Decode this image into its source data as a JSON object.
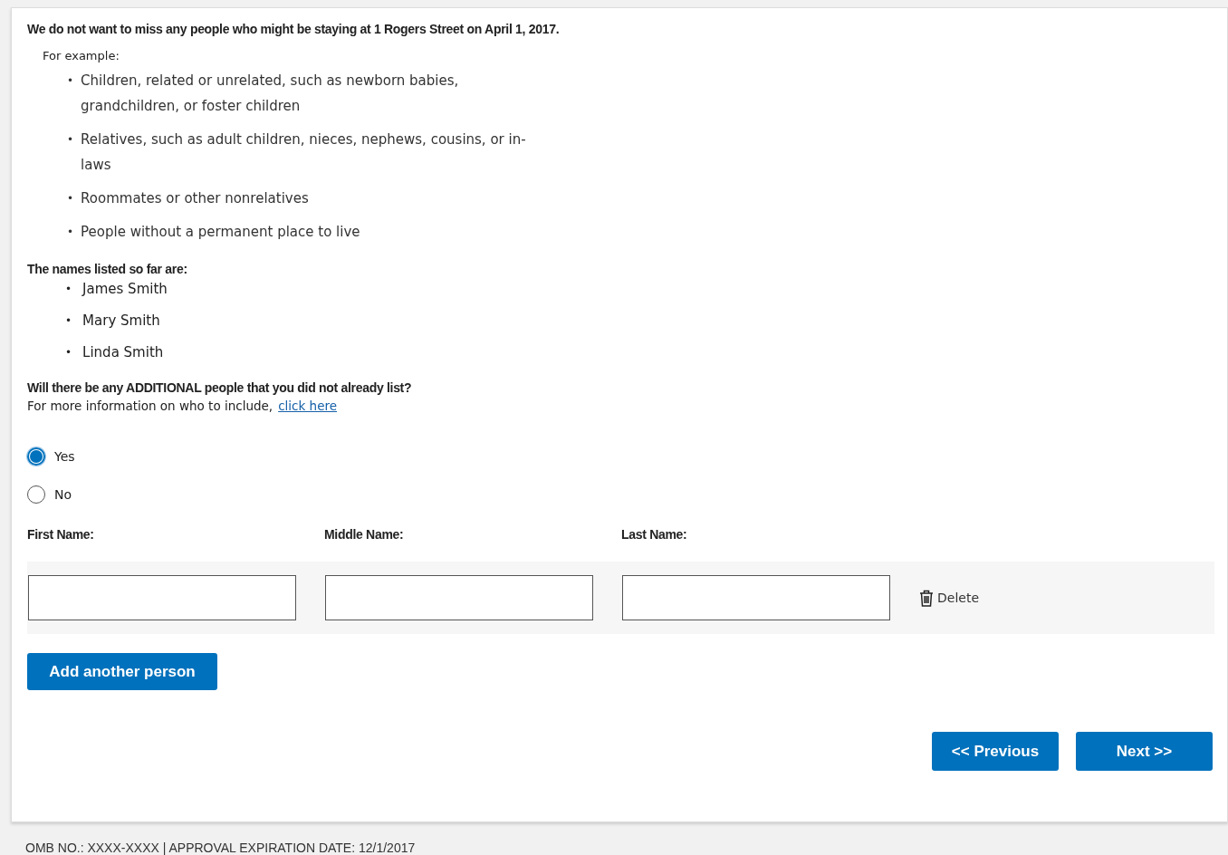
{
  "intro": {
    "heading": "We do not want to miss any people who might be staying at 1 Rogers Street on April 1, 2017.",
    "example_label": "For example:",
    "bullet": "•",
    "examples": [
      "Children, related or unrelated, such as newborn babies, grandchildren, or foster children",
      "Relatives, such as adult children, nieces, nephews, cousins, or in-laws",
      "Roommates or other nonrelatives",
      "People without a permanent place to live"
    ]
  },
  "listed": {
    "heading": "The names listed so far are:",
    "bullet": "•",
    "names": [
      "James Smith",
      "Mary Smith",
      "Linda Smith"
    ]
  },
  "question": {
    "text": "Will there be any ADDITIONAL people that you did not already list?",
    "info": "For more information on who to include,",
    "link": "click here",
    "options": [
      {
        "label": "Yes",
        "selected": true
      },
      {
        "label": "No",
        "selected": false
      }
    ]
  },
  "person_form": {
    "columns": [
      "First Name:",
      "Middle Name:",
      "Last Name:"
    ],
    "delete": "Delete",
    "add_button": "Add another person"
  },
  "navigation": {
    "previous": "<< Previous",
    "next": "Next >>"
  },
  "footer": "OMB NO.: XXXX-XXXX | APPROVAL EXPIRATION DATE: 12/1/2017"
}
